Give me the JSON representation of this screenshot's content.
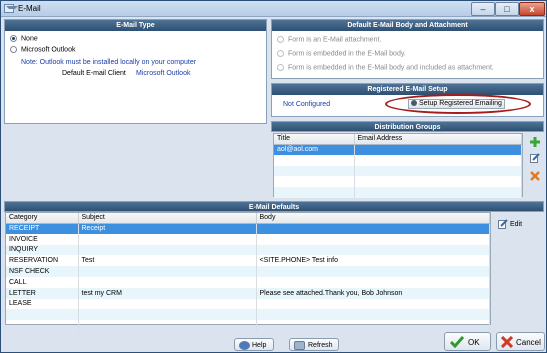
{
  "window": {
    "title": "E-Mail",
    "min": "–",
    "max": "□",
    "close": "x"
  },
  "email_type": {
    "header": "E-Mail Type",
    "options": [
      "None",
      "Microsoft Outlook"
    ],
    "selected": "None",
    "note": "Note: Outlook must be installed locally on your computer",
    "default_client_label": "Default E-mail Client",
    "default_client_value": "Microsoft Outlook"
  },
  "body_attach": {
    "header": "Default E-Mail Body and Attachment",
    "options": [
      "Form is an E-Mail attachment.",
      "Form is embedded in the E-Mail body.",
      "Form is embedded in the E-Mail body and included as attachment."
    ]
  },
  "registered": {
    "header": "Registered E-Mail Setup",
    "status": "Not Configured",
    "setup_label": "Setup Registered Emailing"
  },
  "distribution": {
    "header": "Distribution Groups",
    "columns": [
      "Title",
      "Email Address"
    ],
    "rows": [
      [
        "aol@aol.com",
        ""
      ],
      [
        "",
        ""
      ],
      [
        "",
        ""
      ],
      [
        "",
        ""
      ],
      [
        "",
        ""
      ],
      [
        "",
        ""
      ]
    ]
  },
  "defaults": {
    "header": "E-Mail Defaults",
    "columns": [
      "Category",
      "Subject",
      "Body"
    ],
    "rows": [
      [
        "RECEIPT",
        "Receipt",
        ""
      ],
      [
        "INVOICE",
        "",
        ""
      ],
      [
        "INQUIRY",
        "",
        ""
      ],
      [
        "RESERVATION",
        "Test",
        "<SITE.PHONE> Test info"
      ],
      [
        "NSF CHECK",
        "",
        ""
      ],
      [
        "CALL",
        "",
        ""
      ],
      [
        "LETTER",
        "test my CRM",
        "Please see attached.Thank you, Bob Johnson"
      ],
      [
        "LEASE",
        "",
        ""
      ],
      [
        "",
        "",
        ""
      ],
      [
        "",
        "",
        ""
      ]
    ],
    "edit_label": "Edit"
  },
  "footer": {
    "help": "Help",
    "refresh": "Refresh",
    "ok": "OK",
    "cancel": "Cancel"
  },
  "colors": {
    "header": "#2c4f72",
    "selection": "#3d8fe0",
    "highlight_ring": "#a51c1c",
    "link": "#1a3ea8"
  }
}
